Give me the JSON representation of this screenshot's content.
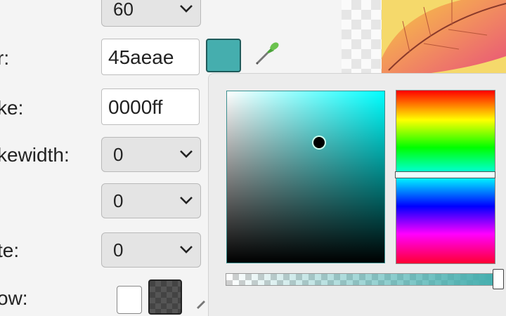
{
  "form": {
    "top_select": {
      "value": "60"
    },
    "fill": {
      "label": "r:",
      "hex": "45aeae",
      "swatch_color": "#45aeae"
    },
    "stroke": {
      "label": "ke:",
      "hex": "0000ff"
    },
    "strokewidth": {
      "label": "kewidth:",
      "value": "0"
    },
    "unlabeled": {
      "value": "0"
    },
    "rotate": {
      "label": "te:",
      "value": "0"
    },
    "shadow": {
      "label": "ow:"
    }
  },
  "icons": {
    "eyedropper": "eyedropper-icon",
    "chevron": "chevron-down-icon"
  },
  "color_picker": {
    "hue_color": "#00ffff",
    "selected_color": "#45aeae"
  }
}
